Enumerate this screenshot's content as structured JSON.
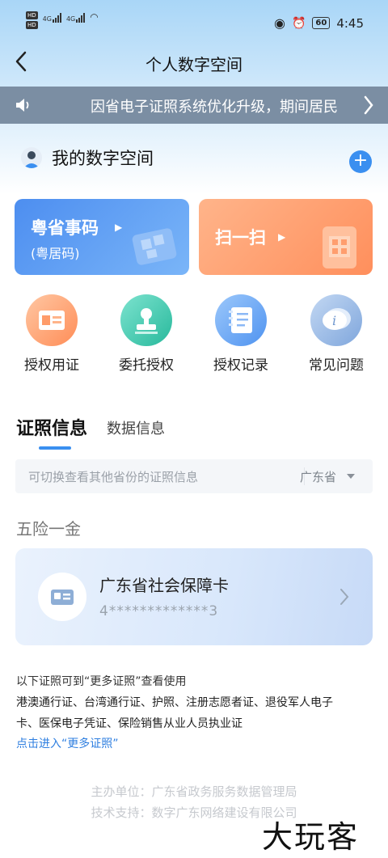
{
  "status_bar": {
    "hd1": "HD",
    "hd2": "HD",
    "sim1": "4G",
    "sim2": "4G",
    "battery": "60",
    "time": "4:45"
  },
  "nav": {
    "title": "个人数字空间"
  },
  "notice": {
    "text": "因省电子证照系统优化升级，期间居民"
  },
  "space": {
    "title": "我的数字空间"
  },
  "cards": {
    "code_title": "粤省事码",
    "code_sub": "(粤居码)",
    "scan_title": "扫一扫"
  },
  "quick_actions": [
    {
      "label": "授权用证"
    },
    {
      "label": "委托授权"
    },
    {
      "label": "授权记录"
    },
    {
      "label": "常见问题"
    }
  ],
  "tabs": {
    "active": "证照信息",
    "inactive": "数据信息"
  },
  "filter": {
    "hint": "可切换查看其他省份的证照信息",
    "province": "广东省"
  },
  "section": {
    "title": "五险一金"
  },
  "certificate": {
    "name": "广东省社会保障卡",
    "number": "4*************3"
  },
  "more_info": {
    "title": "以下证照可到“更多证照”查看使用",
    "line1": "港澳通行证、台湾通行证、护照、注册志愿者证、退役军人电子",
    "line2": "卡、医保电子凭证、保险销售从业人员执业证",
    "link": "点击进入“更多证照”"
  },
  "footer": {
    "sponsor": "主办单位：广东省政务服务数据管理局",
    "support": "技术支持：数字广东网络建设有限公司"
  },
  "watermark": "大玩客",
  "colors": {
    "accent": "#3a8ff0",
    "notice_bg": "#7b8ea3",
    "card_blue": "#4d8ef0",
    "card_orange": "#ff8f5c"
  }
}
